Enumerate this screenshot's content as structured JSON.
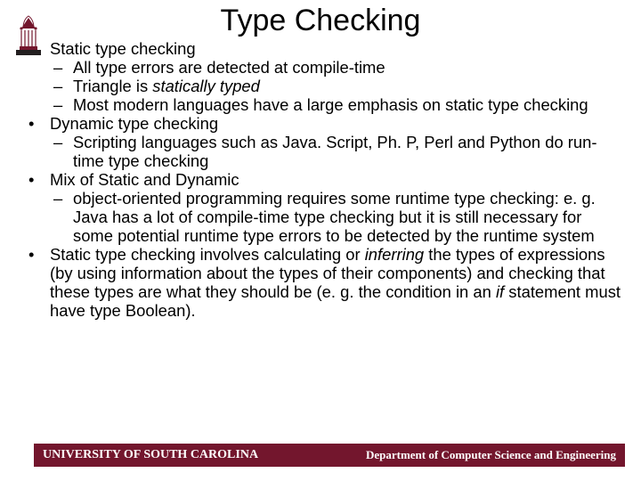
{
  "title": "Type Checking",
  "bullets": {
    "b1": "Static type checking",
    "b1_1": "All type errors are detected at compile-time",
    "b1_2_a": "Triangle is ",
    "b1_2_b": "statically typed",
    "b1_3": "Most modern languages have a large emphasis on static type checking",
    "b2": "Dynamic type checking",
    "b2_1": "Scripting languages such as Java. Script, Ph. P, Perl and Python do run-time type checking",
    "b3": "Mix of Static and Dynamic",
    "b3_1": "object-oriented programming requires some runtime type checking: e. g. Java has a lot of compile-time type checking but it is still necessary for some potential runtime type errors to be detected by the runtime system",
    "b4_a": "Static type checking involves calculating or ",
    "b4_b": "inferring",
    "b4_c": " the types of expressions (by using information about the types of their components) and checking that these types are what they should be (e. g. the condition in an ",
    "b4_d": "if",
    "b4_e": " statement must have type Boolean)."
  },
  "footer": {
    "left": "UNIVERSITY OF SOUTH CAROLINA",
    "right": "Department of Computer Science and Engineering"
  }
}
